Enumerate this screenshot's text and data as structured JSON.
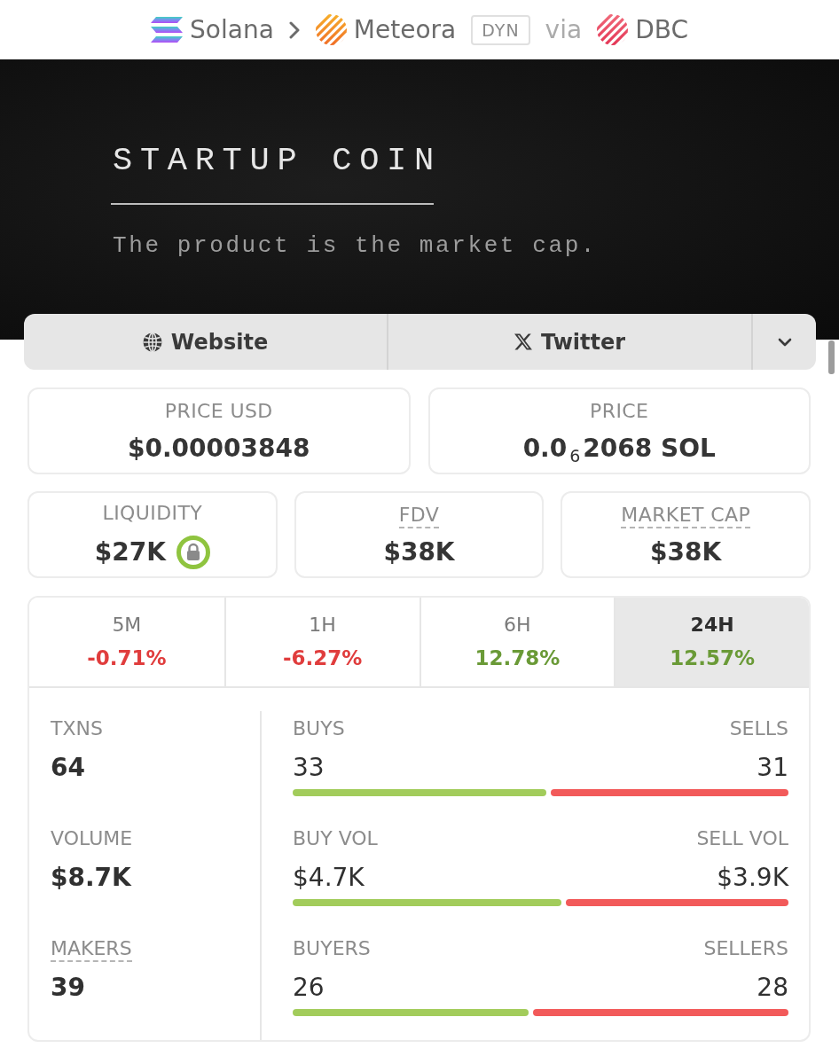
{
  "breadcrumb": {
    "chain": "Solana",
    "dex": "Meteora",
    "pool_type": "DYN",
    "via": "via",
    "launchpad": "DBC"
  },
  "banner": {
    "title": "STARTUP COIN",
    "tagline": "The product is the market cap."
  },
  "links": [
    {
      "kind": "website",
      "label": "Website"
    },
    {
      "kind": "twitter",
      "label": "Twitter"
    }
  ],
  "price_cards": [
    {
      "label": "PRICE USD",
      "value": "$0.00003848"
    },
    {
      "label": "PRICE",
      "value": "0.0$_{6}$2068 SOL"
    }
  ],
  "metric_cards": [
    {
      "label": "LIQUIDITY",
      "value": "$27K",
      "tooltip": false,
      "locked": true
    },
    {
      "label": "FDV",
      "value": "$38K",
      "tooltip": true,
      "locked": false
    },
    {
      "label": "MARKET CAP",
      "value": "$38K",
      "tooltip": true,
      "locked": false
    }
  ],
  "timeframes": [
    {
      "label": "5M",
      "change": "-0.71%",
      "color": "#e03d3d",
      "selected": false
    },
    {
      "label": "1H",
      "change": "-6.27%",
      "color": "#e03d3d",
      "selected": false
    },
    {
      "label": "6H",
      "change": "12.78%",
      "color": "#6a9a37",
      "selected": false
    },
    {
      "label": "24H",
      "change": "12.57%",
      "color": "#6a9a37",
      "selected": true
    }
  ],
  "totals": [
    {
      "label": "TXNS",
      "value": "64",
      "tooltip": false
    },
    {
      "label": "VOLUME",
      "value": "$8.7K",
      "tooltip": false
    },
    {
      "label": "MAKERS",
      "value": "39",
      "tooltip": true
    }
  ],
  "splits": [
    {
      "buy_label": "BUYS",
      "buy_value": "33",
      "sell_label": "SELLS",
      "sell_value": "31",
      "level": 0.516
    },
    {
      "buy_label": "BUY VOL",
      "buy_value": "$4.7K",
      "sell_label": "SELL VOL",
      "sell_value": "$3.9K",
      "level": 0.546
    },
    {
      "buy_label": "BUYERS",
      "buy_value": "26",
      "sell_label": "SELLERS",
      "sell_value": "28",
      "level": 0.481
    }
  ]
}
